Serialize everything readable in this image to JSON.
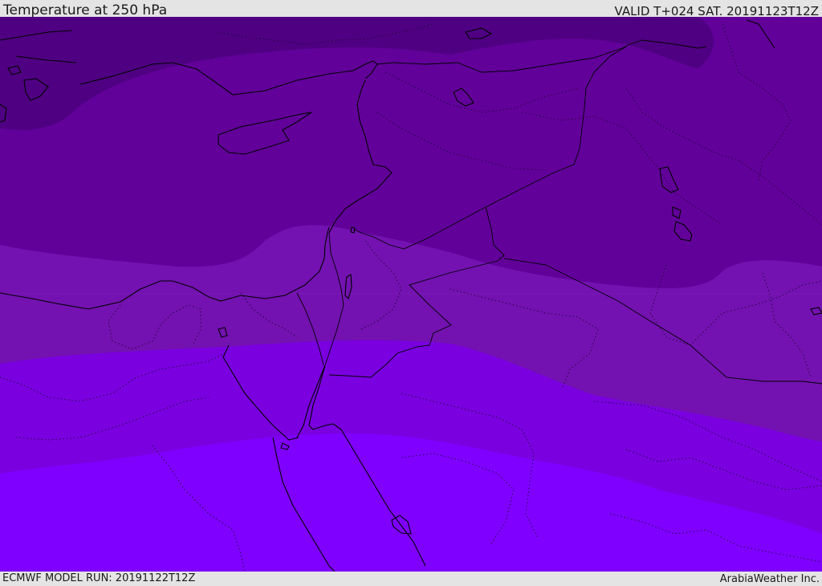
{
  "header": {
    "title": "Temperature at 250 hPa",
    "valid": "VALID T+024 SAT. 20191123T12Z"
  },
  "footer": {
    "model_run": "ECMWF MODEL RUN: 20191122T12Z",
    "credit": "ArabiaWeather Inc."
  },
  "map": {
    "variable": "Temperature",
    "level": "250 hPa",
    "bands": [
      {
        "name": "band-darkest",
        "color": "#4f0082"
      },
      {
        "name": "band-dark",
        "color": "#62009a"
      },
      {
        "name": "band-mid",
        "color": "#7312b0"
      },
      {
        "name": "band-light",
        "color": "#7a00e0"
      },
      {
        "name": "band-lightest",
        "color": "#7f00ff"
      }
    ],
    "coastline_color": "#000000",
    "border_style": "dotted"
  }
}
